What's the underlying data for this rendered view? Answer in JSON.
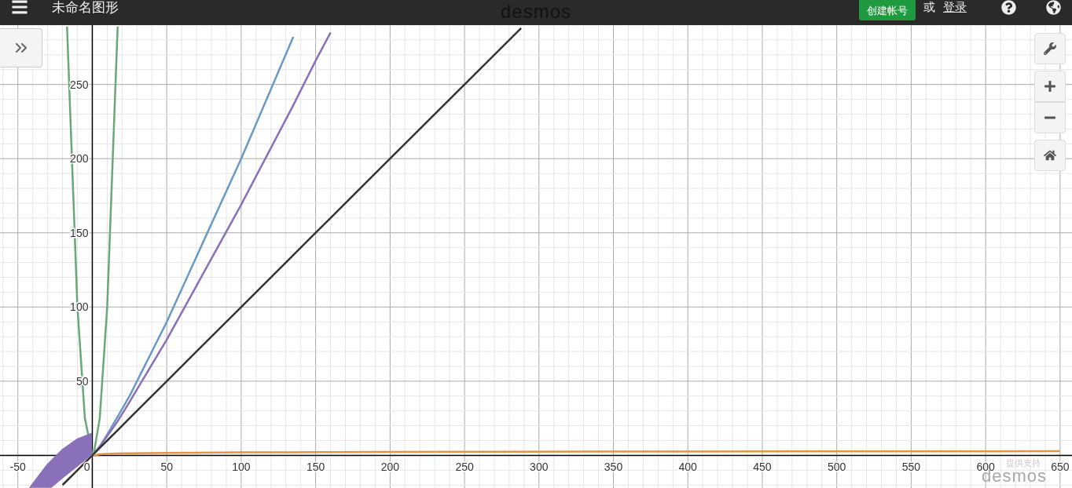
{
  "header": {
    "title": "未命名图形",
    "logo": "desmos",
    "create_account_button": "创建帐号",
    "or_text": "或",
    "login_link": "登录"
  },
  "graph": {
    "chart_data": {
      "type": "line",
      "x": [
        -20,
        -17,
        -10,
        -5,
        0,
        1,
        5,
        10,
        17,
        25,
        50,
        100,
        135,
        150,
        160,
        200,
        288,
        400,
        500,
        650
      ],
      "series": [
        {
          "color": "#6aa87a",
          "values": [
            null,
            289,
            100,
            25,
            0,
            1,
            25,
            100,
            289,
            null,
            null,
            null,
            null,
            null,
            null,
            null,
            null,
            null,
            null,
            null
          ]
        },
        {
          "color": "#6a9ac4",
          "values": [
            null,
            null,
            null,
            null,
            0,
            1,
            6,
            14,
            26,
            40,
            90,
            200,
            282,
            null,
            null,
            null,
            null,
            null,
            null,
            null
          ]
        },
        {
          "color": "#8a70b8",
          "values": [
            null,
            null,
            null,
            null,
            0,
            1,
            6,
            13,
            23,
            36,
            78,
            169,
            236,
            266,
            285,
            null,
            null,
            null,
            null,
            null
          ]
        },
        {
          "color": "#333333",
          "values": [
            -20,
            -17,
            -10,
            -5,
            0,
            1,
            5,
            10,
            17,
            25,
            50,
            100,
            135,
            150,
            160,
            200,
            288,
            null,
            null,
            null
          ]
        },
        {
          "color": "#e0964a",
          "values": [
            null,
            null,
            null,
            null,
            null,
            0,
            0.7,
            1,
            1.2,
            1.4,
            1.7,
            2,
            2.1,
            2.2,
            2.2,
            2.3,
            2.5,
            2.6,
            2.7,
            2.8
          ]
        }
      ],
      "grid": true,
      "xlim": [
        -62,
        658
      ],
      "ylim": [
        -22,
        290
      ],
      "xticks": [
        -50,
        0,
        50,
        100,
        150,
        200,
        250,
        300,
        350,
        400,
        450,
        500,
        550,
        600,
        650
      ],
      "yticks": [
        50,
        100,
        150,
        200,
        250
      ]
    }
  },
  "powered_by": {
    "text": "提供支持",
    "logo": "desmos"
  }
}
